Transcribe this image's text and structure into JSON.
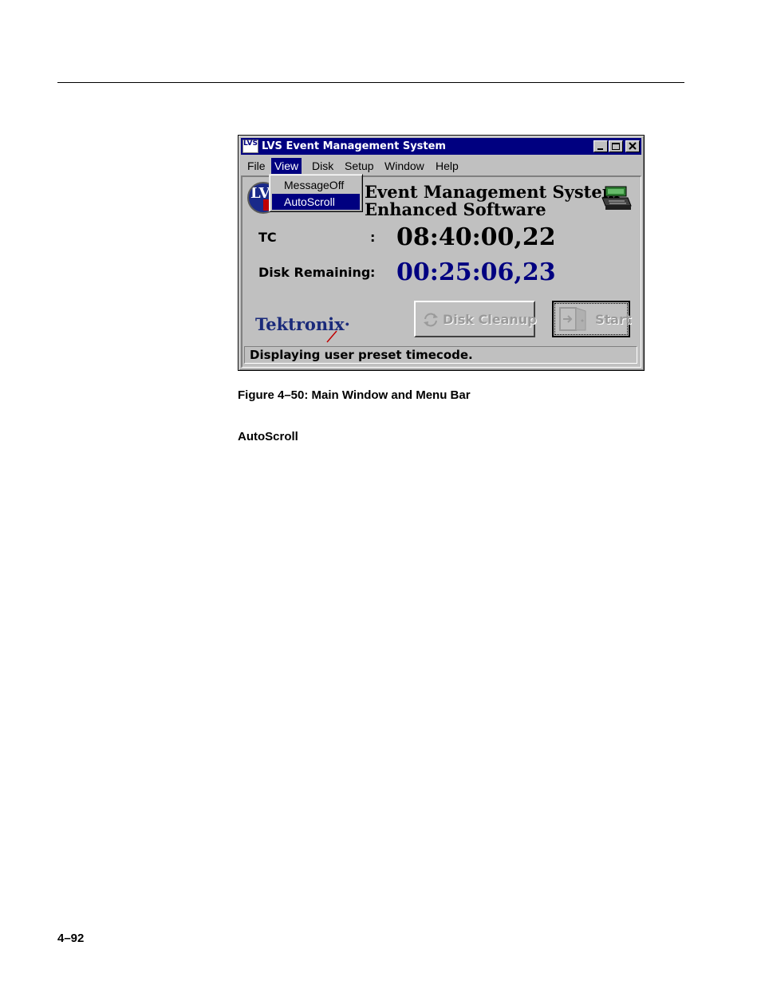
{
  "window": {
    "title": "LVS Event Management System",
    "icon_text": "LVS",
    "caption_buttons": [
      "minimize-icon",
      "maximize-icon",
      "close-icon"
    ]
  },
  "menu": {
    "items": [
      "File",
      "View",
      "Disk",
      "Setup",
      "Window",
      "Help"
    ],
    "active": "View"
  },
  "view_menu": {
    "items": [
      "MessageOff",
      "AutoScroll"
    ],
    "highlighted": "AutoScroll"
  },
  "header": {
    "line1": "Event Management System",
    "line2": "Enhanced Software",
    "logo_text": "LV"
  },
  "fields": {
    "tc_label": "TC",
    "tc_colon": ":",
    "tc_value": "08:40:00,22",
    "disk_label": "Disk Remaining",
    "disk_colon": ":",
    "disk_value": "00:25:06,23"
  },
  "brand": {
    "name": "Tektronix",
    "mark": "·"
  },
  "buttons": {
    "cleanup": "Disk Cleanup",
    "start": "Start"
  },
  "status": "Displaying user preset timecode.",
  "document": {
    "caption": "Figure 4–50: Main Window and Menu Bar",
    "section": "AutoScroll",
    "page_number": "4–92"
  },
  "colors": {
    "titlebar": "#000080",
    "disk_value": "#000080",
    "window_face": "#c0c0c0"
  }
}
